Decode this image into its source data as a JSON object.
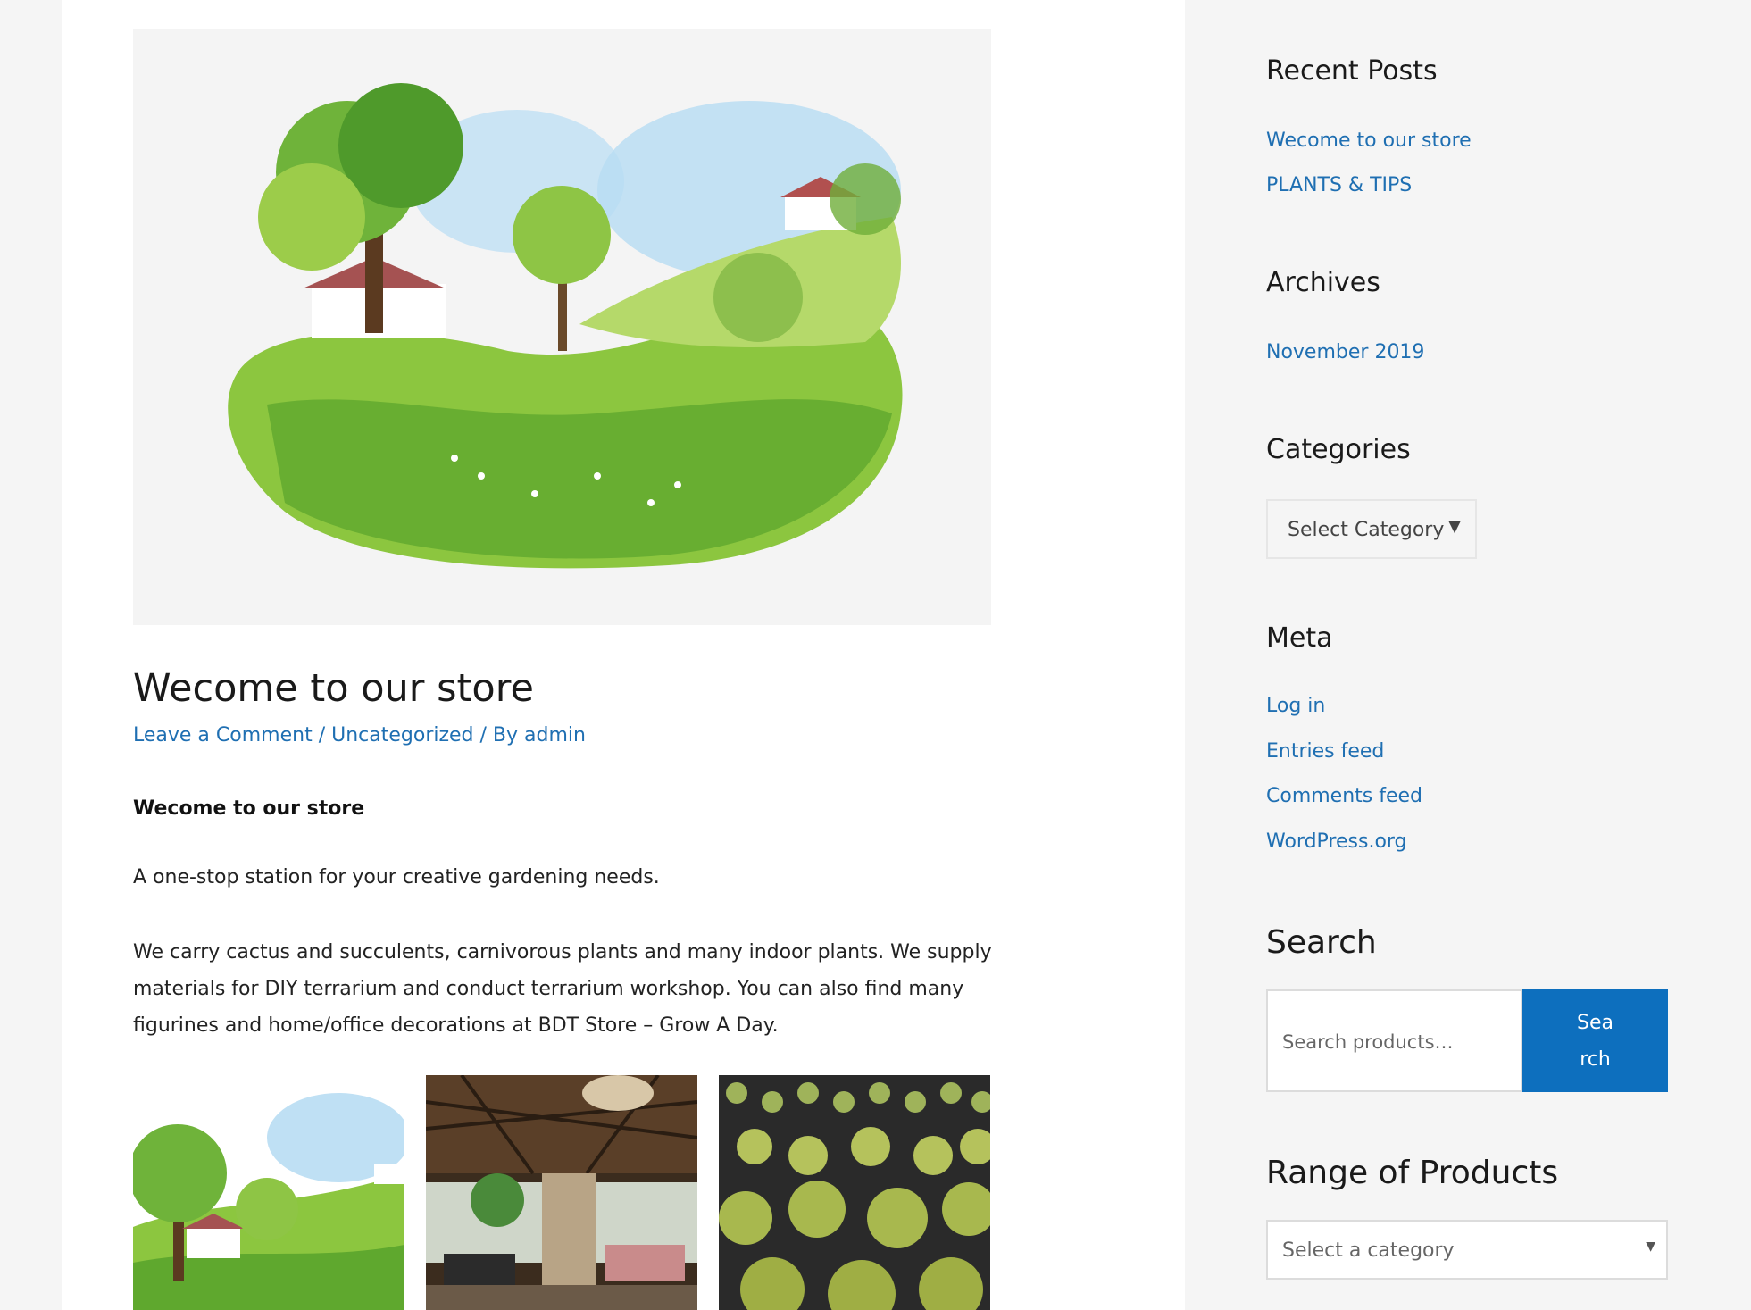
{
  "post": {
    "title": "Wecome to our store",
    "meta": {
      "comment_link": "Leave a Comment",
      "sep1": " / ",
      "category_link": "Uncategorized",
      "sep2": " / By ",
      "author_link": "admin"
    },
    "content_heading": "Wecome to our store",
    "paragraph1": "A one-stop station for your creative gardening needs.",
    "paragraph2": "We carry cactus and succulents, carnivorous plants and many indoor plants. We supply materials for DIY terrarium and conduct terrarium workshop. You can also find many figurines and home/office decorations at BDT Store – Grow A Day."
  },
  "sidebar": {
    "recent_posts": {
      "title": "Recent Posts",
      "items": [
        "Wecome to our store",
        "PLANTS & TIPS"
      ]
    },
    "archives": {
      "title": "Archives",
      "items": [
        "November 2019"
      ]
    },
    "categories": {
      "title": "Categories",
      "select_value": "Select Category"
    },
    "meta": {
      "title": "Meta",
      "items": [
        "Log in",
        "Entries feed",
        "Comments feed",
        "WordPress.org"
      ]
    },
    "search": {
      "title": "Search",
      "placeholder": "Search products…",
      "button_label": "Search"
    },
    "range_of_products": {
      "title": "Range of Products",
      "select_value": "Select a category"
    }
  },
  "colors": {
    "link": "#1f6fb2",
    "button": "#0d6fbe",
    "sidebar_bg": "#f5f5f5"
  }
}
